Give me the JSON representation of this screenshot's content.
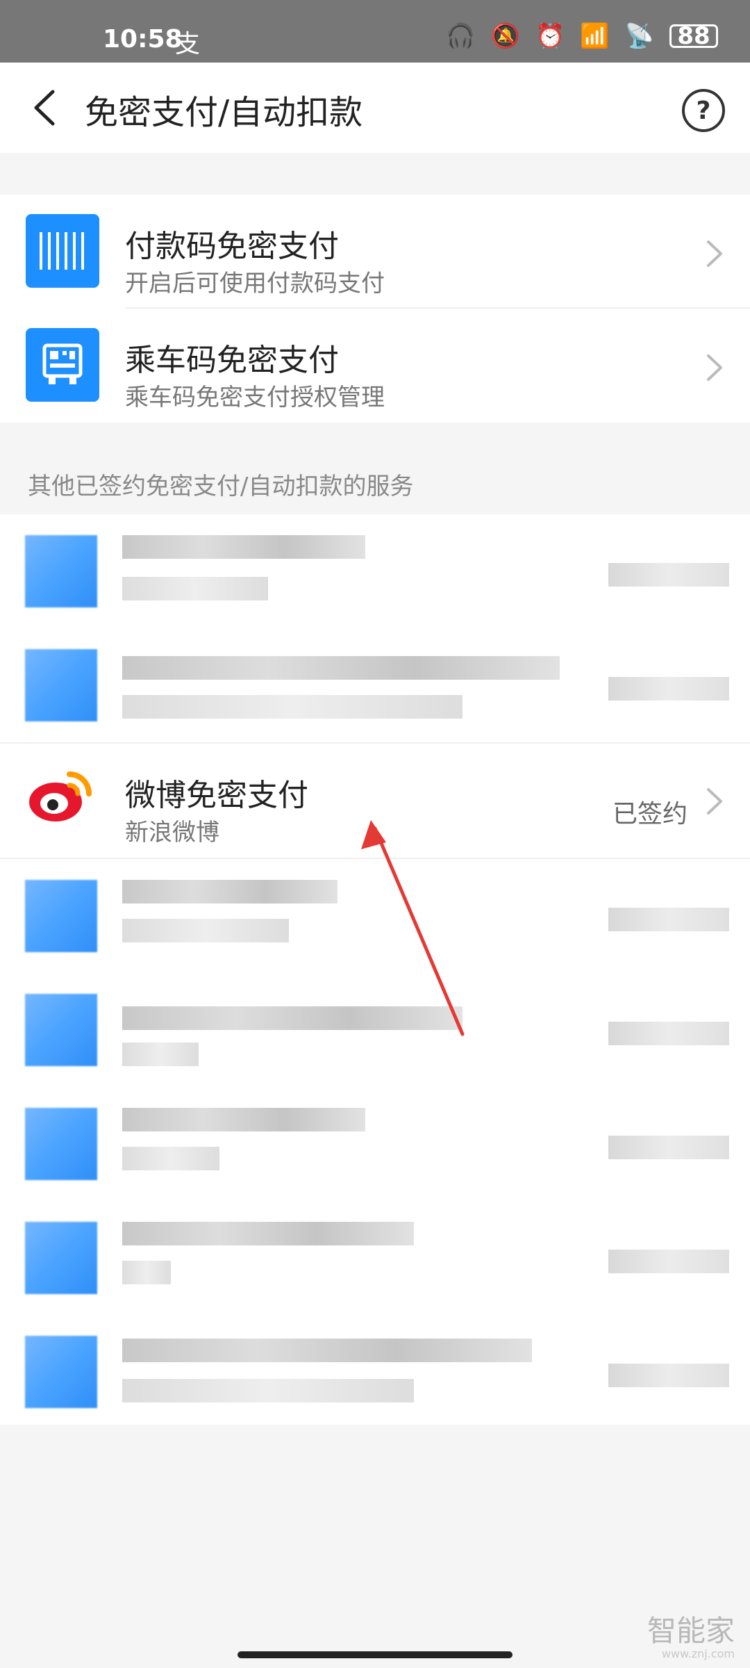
{
  "status_bar": {
    "time": "10:58",
    "alipay_badge": "支",
    "battery": "88",
    "icons": [
      "headphones-icon",
      "bell-off-icon",
      "alarm-icon",
      "hd-signal-icon",
      "wifi-icon",
      "battery-icon"
    ]
  },
  "header": {
    "title": "免密支付/自动扣款",
    "back_icon": "chevron-left-icon",
    "help_icon": "question-mark-icon",
    "help_symbol": "?"
  },
  "quick_services": [
    {
      "title": "付款码免密支付",
      "subtitle": "开启后可使用付款码支付",
      "icon": "barcode-icon"
    },
    {
      "title": "乘车码免密支付",
      "subtitle": "乘车码免密支付授权管理",
      "icon": "bus-qr-icon"
    }
  ],
  "section_label": "其他已签约免密支付/自动扣款的服务",
  "signed_services": {
    "weibo": {
      "title": "微博免密支付",
      "subtitle": "新浪微博",
      "status": "已签约",
      "icon": "weibo-logo-icon"
    }
  },
  "watermark": {
    "brand": "智能家",
    "url": "www.znj.com"
  },
  "colors": {
    "accent": "#1d8fff",
    "status_bar": "#777777",
    "arrow": "#e53935",
    "weibo_red": "#e6162d",
    "weibo_orange": "#ff9a00"
  }
}
